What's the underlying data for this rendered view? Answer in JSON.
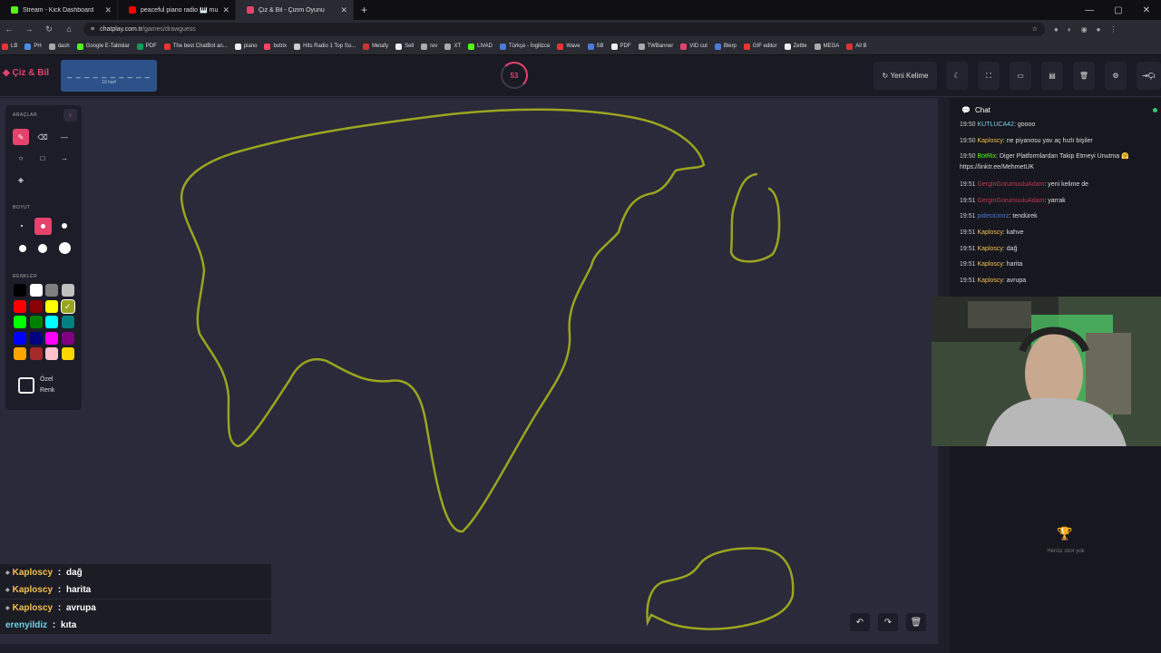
{
  "browser": {
    "tabs": [
      {
        "title": "Stream - Kick Dashboard",
        "color": "#53fc18"
      },
      {
        "title": "peaceful piano radio 🎹 mu",
        "color": "#ff0000"
      },
      {
        "title": "Çiz & Bil - Çizim Oyunu",
        "color": "#e5436b"
      }
    ],
    "url_host": "chatplay.com.tr",
    "url_path": "/games/drawguess",
    "bookmarks": [
      "LB",
      "PH",
      "dash",
      "Google E-Tablolar",
      "PDF",
      "The best ChatBot an...",
      "piano",
      "botrix",
      "Hits Radio 1 Top So...",
      "Metafy",
      "Sell",
      "rev",
      "XT",
      "LIVAD",
      "Türkçe - İngilizce",
      "Wave",
      "SB",
      "PDF",
      "TWBanner",
      "VID cut",
      "Blerp",
      "GIF editor",
      "Zettle",
      "MEGA",
      "All B"
    ]
  },
  "header": {
    "logo": "Çiz & Bil",
    "word_hint": "_ _ _ _ _ _ _ _ _ _",
    "letter_count": "10 harf",
    "timer": "53",
    "new_word": "Yeni Kelime",
    "exit": "Çı"
  },
  "tools": {
    "tools_label": "ARAÇLAR",
    "size_label": "BOYUT",
    "colors_label": "RENKLER",
    "custom_color_line1": "Özel",
    "custom_color_line2": "Renk",
    "colors": [
      "#000000",
      "#ffffff",
      "#808080",
      "#c0c0c0",
      "#ff0000",
      "#8b0000",
      "#ffff00",
      "#9aa51f",
      "#00ff00",
      "#008000",
      "#00ffff",
      "#008080",
      "#0000ff",
      "#000080",
      "#ff00ff",
      "#800080",
      "#ffa500",
      "#a52a2a",
      "#ffc0cb",
      "#ffd700"
    ],
    "selected_color": "#9aa51f"
  },
  "guesses": [
    {
      "user": "Kaploscy",
      "text": "dağ"
    },
    {
      "user": "Kaploscy",
      "text": "harita"
    },
    {
      "user": "Kaploscy",
      "text": "avrupa"
    },
    {
      "user": "erenyildiz",
      "text": "kıta"
    }
  ],
  "chat": {
    "title": "Chat",
    "messages": [
      {
        "time": "19:50",
        "user": "KUTLUCA42",
        "color": "#6fd3e8",
        "text": ": goooo"
      },
      {
        "time": "19:50",
        "user": "Kaploscy",
        "color": "#f2c14e",
        "text": ": ne piyanosu yav aç hızlı bişiler"
      },
      {
        "time": "19:50",
        "user": "BotRix",
        "color": "#53fc18",
        "text": ": Diger Platformlardan Takip Etmeyi Unutma 🤗 https://linktr.ee/MehmetUK"
      },
      {
        "time": "19:51",
        "user": "GerginGorumuuluAdam",
        "color": "#c0394f",
        "text": ": yeni kelime de"
      },
      {
        "time": "19:51",
        "user": "GerginGorumuuluAdam",
        "color": "#c0394f",
        "text": ": yarrak"
      },
      {
        "time": "19:51",
        "user": "pidecicimrz",
        "color": "#4a7bd8",
        "text": ": tendürek"
      },
      {
        "time": "19:51",
        "user": "Kaploscy",
        "color": "#f2c14e",
        "text": ": kahve"
      },
      {
        "time": "19:51",
        "user": "Kaploscy",
        "color": "#f2c14e",
        "text": ": dağ"
      },
      {
        "time": "19:51",
        "user": "Kaploscy",
        "color": "#f2c14e",
        "text": ": harita"
      },
      {
        "time": "19:51",
        "user": "Kaploscy",
        "color": "#f2c14e",
        "text": ": avrupa"
      }
    ],
    "no_score": "Henüz skor yok"
  },
  "colors": {
    "accent": "#e5436b",
    "stroke": "#9aa51f"
  }
}
